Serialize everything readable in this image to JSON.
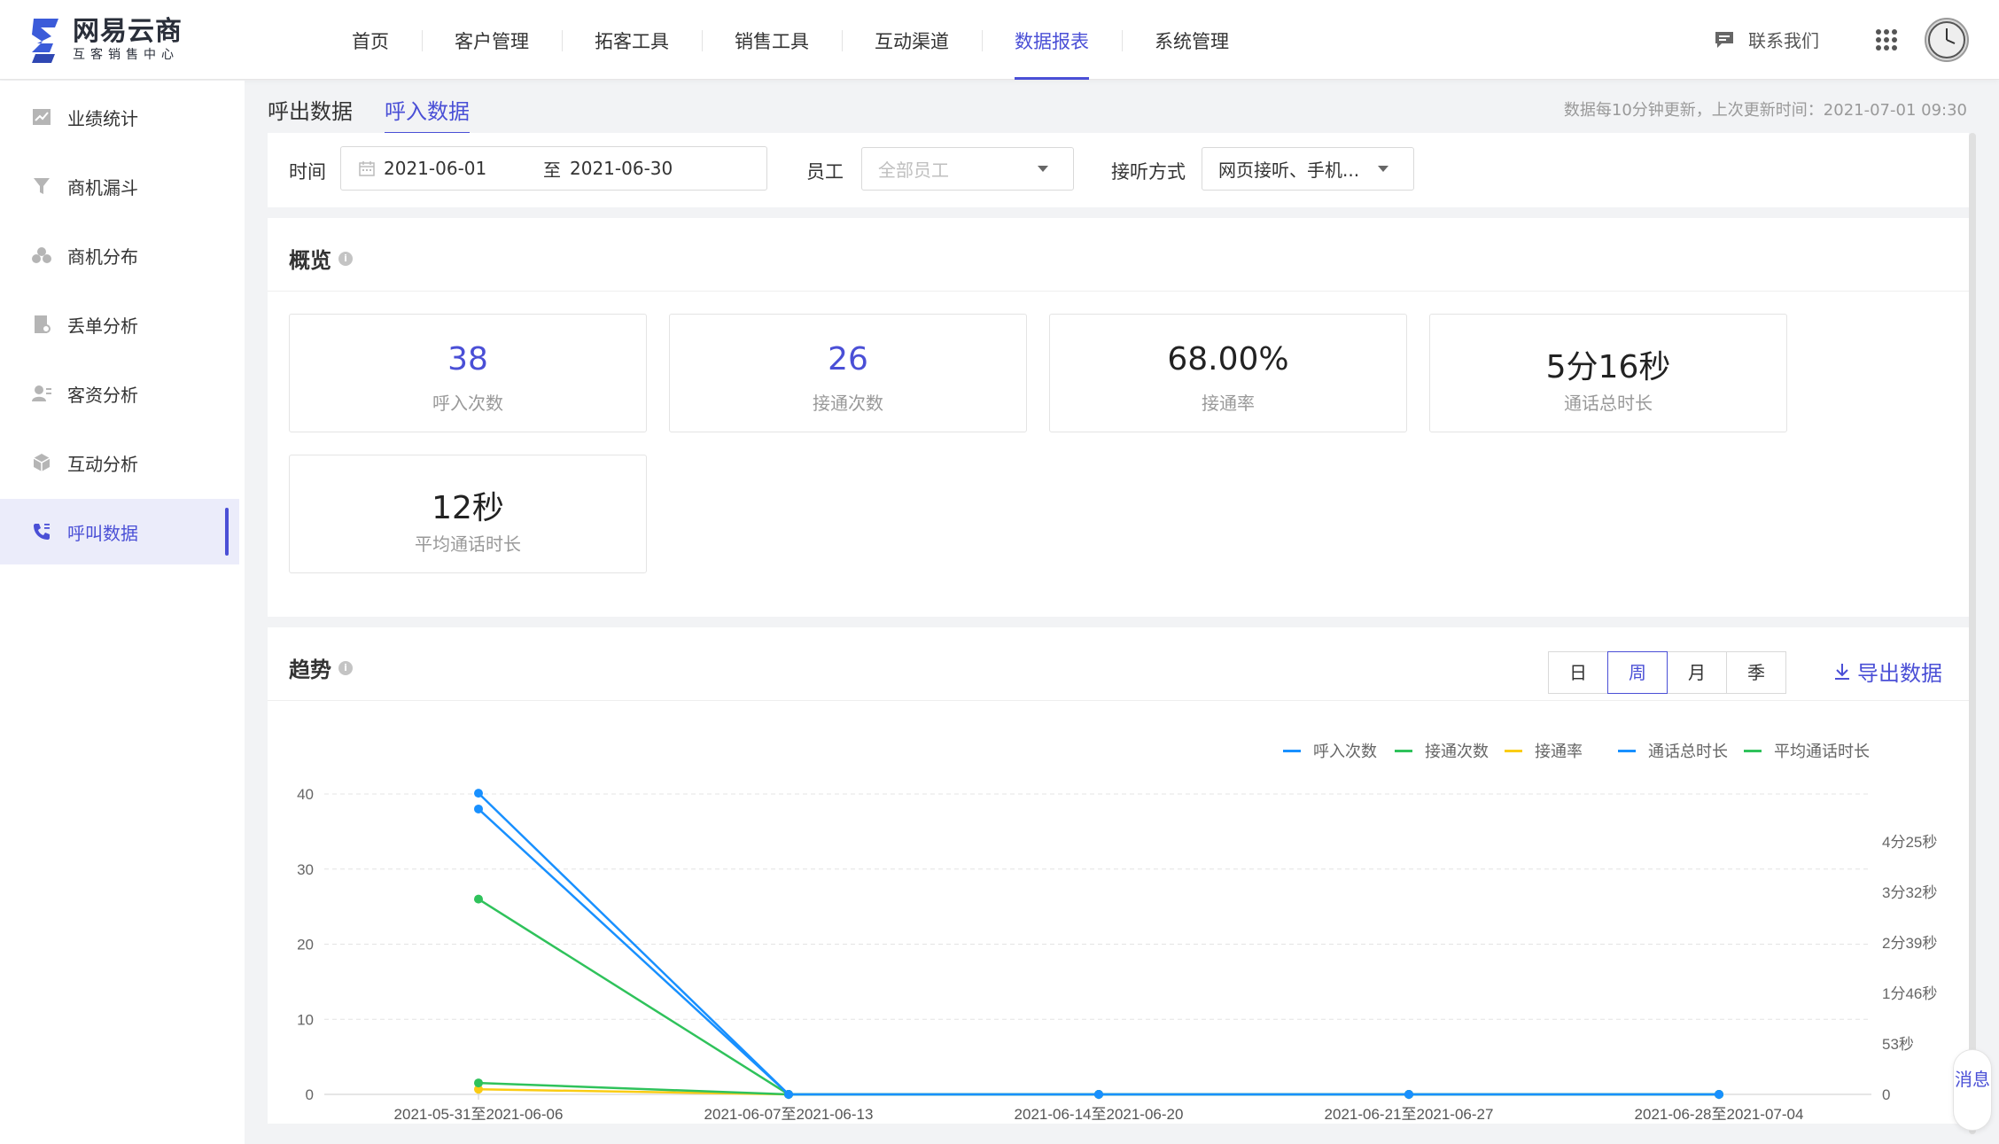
{
  "header": {
    "logo_title": "网易云商",
    "logo_sub": "互客销售中心",
    "nav": [
      "首页",
      "客户管理",
      "拓客工具",
      "销售工具",
      "互动渠道",
      "数据报表",
      "系统管理"
    ],
    "nav_active_index": 5,
    "contact_label": "联系我们"
  },
  "sidebar": {
    "items": [
      {
        "label": "业绩统计",
        "icon": "trend-chart-icon"
      },
      {
        "label": "商机漏斗",
        "icon": "funnel-icon"
      },
      {
        "label": "商机分布",
        "icon": "cluster-icon"
      },
      {
        "label": "丢单分析",
        "icon": "document-icon"
      },
      {
        "label": "客资分析",
        "icon": "user-card-icon"
      },
      {
        "label": "互动分析",
        "icon": "cube-icon"
      },
      {
        "label": "呼叫数据",
        "icon": "phone-icon"
      }
    ],
    "active_index": 6
  },
  "subtabs": [
    "呼出数据",
    "呼入数据"
  ],
  "subtab_active_index": 1,
  "update_time": "数据每10分钟更新，上次更新时间：2021-07-01 09:30",
  "filters": {
    "time_label": "时间",
    "date_start": "2021-06-01",
    "date_sep": "至",
    "date_end": "2021-06-30",
    "staff_label": "员工",
    "staff_placeholder": "全部员工",
    "answer_label": "接听方式",
    "answer_value": "网页接听、手机..."
  },
  "overview": {
    "title": "概览",
    "info_icon": "i",
    "cards": [
      {
        "value": "38",
        "label": "呼入次数"
      },
      {
        "value": "26",
        "label": "接通次数"
      },
      {
        "value": "68.00%",
        "label": "接通率"
      },
      {
        "value": "5分16秒",
        "label": "通话总时长"
      },
      {
        "value": "12秒",
        "label": "平均通话时长"
      }
    ]
  },
  "trend": {
    "title": "趋势",
    "info_icon": "i",
    "periods": [
      "日",
      "周",
      "月",
      "季"
    ],
    "period_active_index": 1,
    "export_label": "导出数据"
  },
  "chart_data": {
    "type": "line",
    "categories": [
      "2021-05-31至2021-06-06",
      "2021-06-07至2021-06-13",
      "2021-06-14至2021-06-20",
      "2021-06-21至2021-06-27",
      "2021-06-28至2021-07-04"
    ],
    "y_left": {
      "ticks": [
        "0",
        "10",
        "20",
        "30",
        "40"
      ],
      "lim": [
        0,
        40
      ]
    },
    "y_right": {
      "ticks": [
        "0",
        "53秒",
        "1分46秒",
        "2分39秒",
        "3分32秒",
        "4分25秒"
      ],
      "lim_seconds": [
        0,
        265
      ]
    },
    "series": [
      {
        "name": "呼入次数",
        "color": "#1890ff",
        "axis": "left",
        "values": [
          38,
          0,
          0,
          0,
          0
        ]
      },
      {
        "name": "接通次数",
        "color": "#2fc25b",
        "axis": "left",
        "values": [
          26,
          0,
          0,
          0,
          0
        ]
      },
      {
        "name": "接通率",
        "color": "#facc14",
        "axis": "left",
        "values": [
          0.68,
          0,
          0,
          0,
          0
        ]
      },
      {
        "name": "通话总时长",
        "color": "#1890ff",
        "axis": "right",
        "values": [
          316,
          0,
          0,
          0,
          0
        ]
      },
      {
        "name": "平均通话时长",
        "color": "#2fc25b",
        "axis": "right",
        "values": [
          12,
          0,
          0,
          0,
          0
        ]
      }
    ],
    "grid": true,
    "legend_position": "top-right"
  },
  "float_message": "消息"
}
